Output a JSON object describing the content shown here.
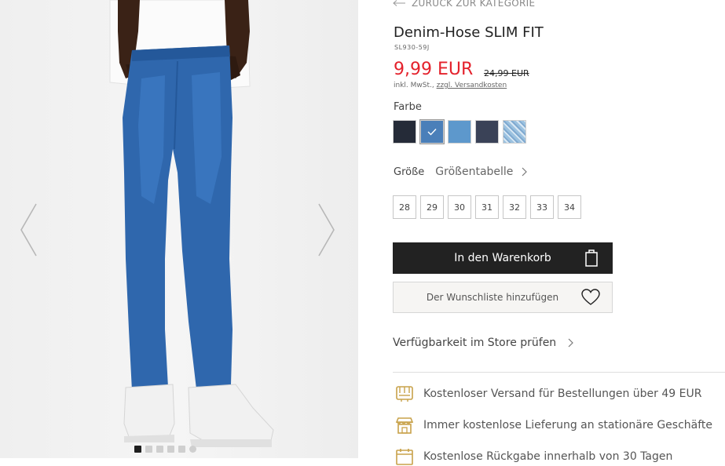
{
  "gallery": {
    "prev_icon": "chevron-left-icon",
    "next_icon": "chevron-right-icon",
    "slide_count": 6,
    "active_slide": 1
  },
  "product": {
    "back_link": "ZURÜCK ZUR KATEGORIE",
    "back_icon": "arrow-left-icon",
    "title": "Denim-Hose SLIM FIT",
    "sku": "SL930-59J",
    "price": "9,99 EUR",
    "old_price": "24,99 EUR",
    "tax_prefix": "inkl. MwSt.,",
    "tax_link": "zzgl. Versandkosten",
    "price_color": "#e4222c"
  },
  "color": {
    "label": "Farbe",
    "swatches": [
      {
        "color": "#252b38",
        "selected": false
      },
      {
        "color": "#4a7fb9",
        "selected": true
      },
      {
        "color": "#5d98cc",
        "selected": false
      },
      {
        "color": "#3a4257",
        "selected": false
      },
      {
        "color": "#9cc2e0",
        "selected": false
      }
    ]
  },
  "size": {
    "label": "Größe",
    "guide_link": "Größentabelle",
    "options": [
      "28",
      "29",
      "30",
      "31",
      "32",
      "33",
      "34"
    ]
  },
  "actions": {
    "add_to_cart": "In den Warenkorb",
    "cart_icon": "shopping-bag-icon",
    "wishlist": "Der Wunschliste hinzufügen",
    "wishlist_icon": "heart-icon",
    "store_check": "Verfügbarkeit im Store prüfen"
  },
  "benefits": [
    {
      "icon": "truck-icon",
      "text": "Kostenloser Versand für Bestellungen über 49 EUR"
    },
    {
      "icon": "store-icon",
      "text": "Immer kostenlose Lieferung an stationäre Geschäfte"
    },
    {
      "icon": "calendar-icon",
      "text": "Kostenlose Rückgabe innerhalb von 30 Tagen"
    }
  ],
  "accent_color": "#c8a24a"
}
